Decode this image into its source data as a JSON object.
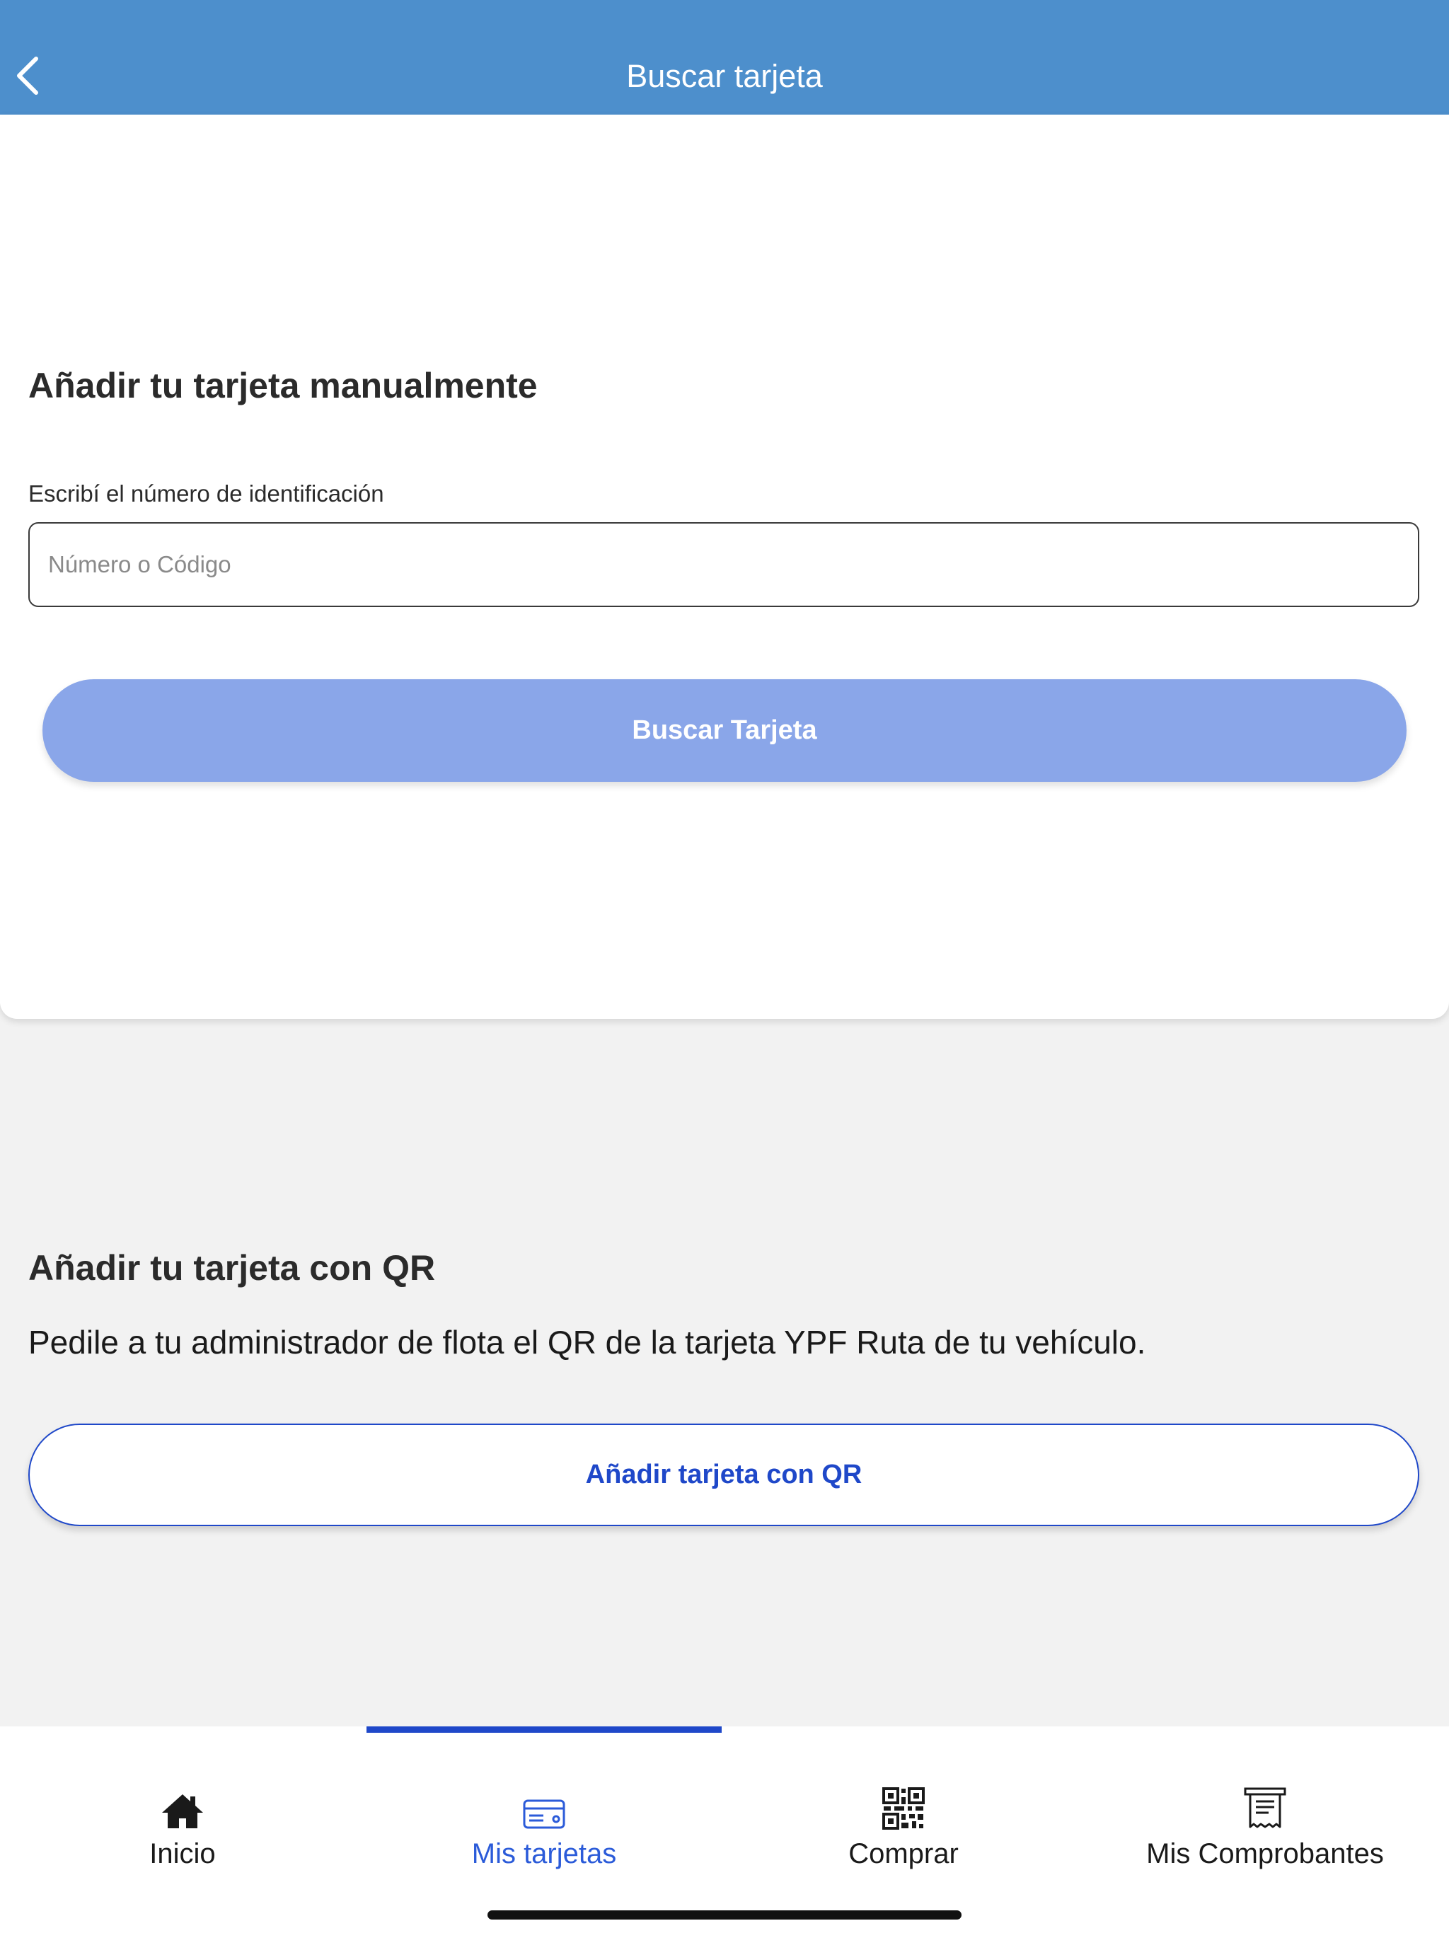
{
  "header": {
    "title": "Buscar tarjeta",
    "background": "#4d8fcc"
  },
  "manual": {
    "title": "Añadir tu tarjeta manualmente",
    "field_label": "Escribí el número de identificación",
    "input_placeholder": "Número o Código",
    "input_value": "",
    "search_button": "Buscar Tarjeta"
  },
  "qr": {
    "title": "Añadir tu tarjeta con QR",
    "description": "Pedile a tu administrador de flota el QR de la tarjeta YPF Ruta de tu vehículo.",
    "button": "Añadir tarjeta con QR"
  },
  "tabs": [
    {
      "label": "Inicio",
      "icon": "home-icon",
      "active": false
    },
    {
      "label": "Mis tarjetas",
      "icon": "credit-card-icon",
      "active": true
    },
    {
      "label": "Comprar",
      "icon": "qr-code-icon",
      "active": false
    },
    {
      "label": "Mis Comprobantes",
      "icon": "receipt-icon",
      "active": false
    }
  ],
  "colors": {
    "accent": "#1f48c9",
    "button_disabled": "#8aa6e9",
    "background": "#f2f2f2"
  }
}
